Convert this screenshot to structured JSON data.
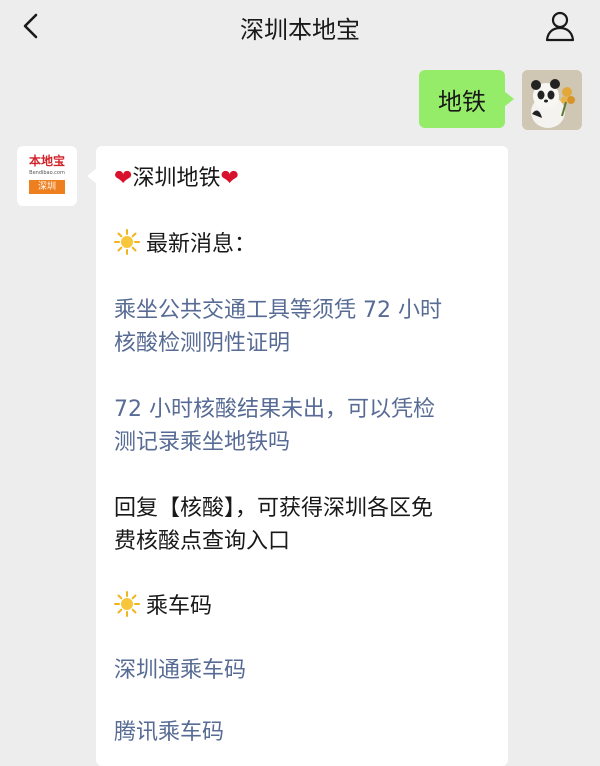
{
  "header": {
    "title": "深圳本地宝",
    "back_icon": "chevron-left-icon",
    "profile_icon": "person-icon"
  },
  "outgoing": {
    "text": "地铁"
  },
  "brand_avatar": {
    "logo_text": "本地宝",
    "logo_url": "Bendibao.com",
    "logo_city": "深圳"
  },
  "reply": {
    "heading_heart_left": "❤",
    "heading": "深圳地铁",
    "heading_heart_right": "❤",
    "section1_title": "最新消息：",
    "link1_line1": "乘坐公共交通工具等须凭 72 小时",
    "link1_line2": "核酸检测阴性证明",
    "link2_line1": "72 小时核酸结果未出，可以凭检",
    "link2_line2": "测记录乘坐地铁吗",
    "reply_prefix": "回复",
    "reply_keyword": "【核酸】",
    "reply_suffix": "，可获得深圳各区免",
    "reply_line2": "费核酸点查询入口",
    "section2_title": "乘车码",
    "link3": "深圳通乘车码",
    "link4_partial": "腾讯乘车码"
  },
  "colors": {
    "background": "#ededed",
    "outgoing_bubble": "#95ec69",
    "link": "#576b95",
    "heart": "#d8112c",
    "sun": "#f2b41c"
  }
}
